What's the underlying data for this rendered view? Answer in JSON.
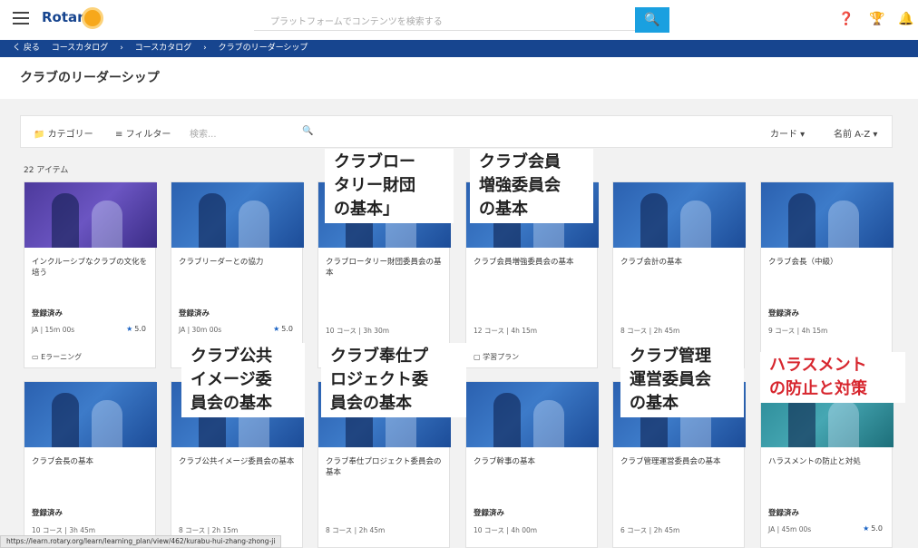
{
  "header": {
    "brand": "Rotary",
    "search_placeholder": "プラットフォームでコンテンツを検索する",
    "search_button_icon": "search-icon"
  },
  "breadcrumb": {
    "back": "く 戻る",
    "items": [
      "コースカタログ",
      "›",
      "コースカタログ",
      "›",
      "クラブのリーダーシップ"
    ]
  },
  "page_title": "クラブのリーダーシップ",
  "toolbar": {
    "category": "カテゴリー",
    "filter": "フィルター",
    "search_placeholder": "検索...",
    "view": "カード ▾",
    "sort": "名前 A-Z ▾"
  },
  "item_count": "22 アイテム",
  "cards": [
    {
      "title": "インクルーシブなクラブの文化を培う",
      "status": "登録済み",
      "meta": "JA | 15m 00s",
      "rating": "5.0",
      "type": "Eラーニング"
    },
    {
      "title": "クラブリーダーとの協力",
      "status": "登録済み",
      "meta": "JA | 30m 00s",
      "rating": "5.0",
      "type": ""
    },
    {
      "title": "クラブロータリー財団委員会の基本",
      "status": "",
      "meta": "10 コース | 3h 30m",
      "rating": "",
      "type": ""
    },
    {
      "title": "クラブ会員増強委員会の基本",
      "status": "",
      "meta": "12 コース | 4h 15m",
      "rating": "",
      "type": "学習プラン"
    },
    {
      "title": "クラブ会計の基本",
      "status": "",
      "meta": "8 コース | 2h 45m",
      "rating": "",
      "type": ""
    },
    {
      "title": "クラブ会長（中級）",
      "status": "登録済み",
      "meta": "9 コース | 4h 15m",
      "rating": "",
      "type": ""
    },
    {
      "title": "クラブ会長の基本",
      "status": "登録済み",
      "meta": "10 コース | 3h 45m",
      "rating": "",
      "type": ""
    },
    {
      "title": "クラブ公共イメージ委員会の基本",
      "status": "",
      "meta": "8 コース | 2h 15m",
      "rating": "",
      "type": ""
    },
    {
      "title": "クラブ奉仕プロジェクト委員会の基本",
      "status": "",
      "meta": "8 コース | 2h 45m",
      "rating": "",
      "type": ""
    },
    {
      "title": "クラブ幹事の基本",
      "status": "登録済み",
      "meta": "10 コース | 4h 00m",
      "rating": "",
      "type": ""
    },
    {
      "title": "クラブ管理運営委員会の基本",
      "status": "",
      "meta": "6 コース | 2h 45m",
      "rating": "",
      "type": ""
    },
    {
      "title": "ハラスメントの防止と対処",
      "status": "登録済み",
      "meta": "JA | 45m 00s",
      "rating": "5.0",
      "type": ""
    }
  ],
  "overlays": [
    "クラブロー\nタリー財団\nの基本」",
    "クラブ会員\n増強委員会\nの基本",
    "クラブ公共\nイメージ委\n員会の基本",
    "クラブ奉仕プ\nロジェクト委\n員会の基本",
    "クラブ管理\n運営委員会\nの基本",
    "ハラスメント\nの防止と対策"
  ],
  "status_url": "https://learn.rotary.org/learn/learning_plan/view/462/kurabu-hui-zhang-zhong-ji",
  "colors": {
    "brand_blue": "#17458f",
    "accent": "#1aa0e0",
    "overlay_red": "#d7262e"
  }
}
